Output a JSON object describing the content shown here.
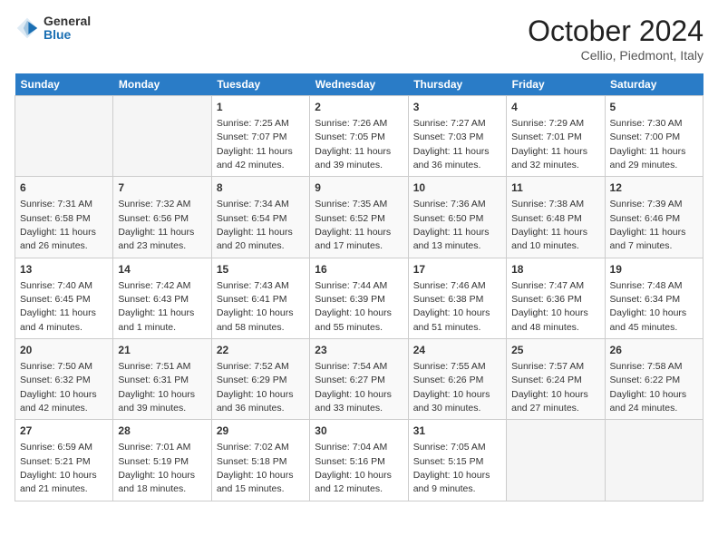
{
  "logo": {
    "general": "General",
    "blue": "Blue"
  },
  "title": "October 2024",
  "location": "Cellio, Piedmont, Italy",
  "days_header": [
    "Sunday",
    "Monday",
    "Tuesday",
    "Wednesday",
    "Thursday",
    "Friday",
    "Saturday"
  ],
  "weeks": [
    [
      {
        "day": "",
        "sunrise": "",
        "sunset": "",
        "daylight": ""
      },
      {
        "day": "",
        "sunrise": "",
        "sunset": "",
        "daylight": ""
      },
      {
        "day": "1",
        "sunrise": "Sunrise: 7:25 AM",
        "sunset": "Sunset: 7:07 PM",
        "daylight": "Daylight: 11 hours and 42 minutes."
      },
      {
        "day": "2",
        "sunrise": "Sunrise: 7:26 AM",
        "sunset": "Sunset: 7:05 PM",
        "daylight": "Daylight: 11 hours and 39 minutes."
      },
      {
        "day": "3",
        "sunrise": "Sunrise: 7:27 AM",
        "sunset": "Sunset: 7:03 PM",
        "daylight": "Daylight: 11 hours and 36 minutes."
      },
      {
        "day": "4",
        "sunrise": "Sunrise: 7:29 AM",
        "sunset": "Sunset: 7:01 PM",
        "daylight": "Daylight: 11 hours and 32 minutes."
      },
      {
        "day": "5",
        "sunrise": "Sunrise: 7:30 AM",
        "sunset": "Sunset: 7:00 PM",
        "daylight": "Daylight: 11 hours and 29 minutes."
      }
    ],
    [
      {
        "day": "6",
        "sunrise": "Sunrise: 7:31 AM",
        "sunset": "Sunset: 6:58 PM",
        "daylight": "Daylight: 11 hours and 26 minutes."
      },
      {
        "day": "7",
        "sunrise": "Sunrise: 7:32 AM",
        "sunset": "Sunset: 6:56 PM",
        "daylight": "Daylight: 11 hours and 23 minutes."
      },
      {
        "day": "8",
        "sunrise": "Sunrise: 7:34 AM",
        "sunset": "Sunset: 6:54 PM",
        "daylight": "Daylight: 11 hours and 20 minutes."
      },
      {
        "day": "9",
        "sunrise": "Sunrise: 7:35 AM",
        "sunset": "Sunset: 6:52 PM",
        "daylight": "Daylight: 11 hours and 17 minutes."
      },
      {
        "day": "10",
        "sunrise": "Sunrise: 7:36 AM",
        "sunset": "Sunset: 6:50 PM",
        "daylight": "Daylight: 11 hours and 13 minutes."
      },
      {
        "day": "11",
        "sunrise": "Sunrise: 7:38 AM",
        "sunset": "Sunset: 6:48 PM",
        "daylight": "Daylight: 11 hours and 10 minutes."
      },
      {
        "day": "12",
        "sunrise": "Sunrise: 7:39 AM",
        "sunset": "Sunset: 6:46 PM",
        "daylight": "Daylight: 11 hours and 7 minutes."
      }
    ],
    [
      {
        "day": "13",
        "sunrise": "Sunrise: 7:40 AM",
        "sunset": "Sunset: 6:45 PM",
        "daylight": "Daylight: 11 hours and 4 minutes."
      },
      {
        "day": "14",
        "sunrise": "Sunrise: 7:42 AM",
        "sunset": "Sunset: 6:43 PM",
        "daylight": "Daylight: 11 hours and 1 minute."
      },
      {
        "day": "15",
        "sunrise": "Sunrise: 7:43 AM",
        "sunset": "Sunset: 6:41 PM",
        "daylight": "Daylight: 10 hours and 58 minutes."
      },
      {
        "day": "16",
        "sunrise": "Sunrise: 7:44 AM",
        "sunset": "Sunset: 6:39 PM",
        "daylight": "Daylight: 10 hours and 55 minutes."
      },
      {
        "day": "17",
        "sunrise": "Sunrise: 7:46 AM",
        "sunset": "Sunset: 6:38 PM",
        "daylight": "Daylight: 10 hours and 51 minutes."
      },
      {
        "day": "18",
        "sunrise": "Sunrise: 7:47 AM",
        "sunset": "Sunset: 6:36 PM",
        "daylight": "Daylight: 10 hours and 48 minutes."
      },
      {
        "day": "19",
        "sunrise": "Sunrise: 7:48 AM",
        "sunset": "Sunset: 6:34 PM",
        "daylight": "Daylight: 10 hours and 45 minutes."
      }
    ],
    [
      {
        "day": "20",
        "sunrise": "Sunrise: 7:50 AM",
        "sunset": "Sunset: 6:32 PM",
        "daylight": "Daylight: 10 hours and 42 minutes."
      },
      {
        "day": "21",
        "sunrise": "Sunrise: 7:51 AM",
        "sunset": "Sunset: 6:31 PM",
        "daylight": "Daylight: 10 hours and 39 minutes."
      },
      {
        "day": "22",
        "sunrise": "Sunrise: 7:52 AM",
        "sunset": "Sunset: 6:29 PM",
        "daylight": "Daylight: 10 hours and 36 minutes."
      },
      {
        "day": "23",
        "sunrise": "Sunrise: 7:54 AM",
        "sunset": "Sunset: 6:27 PM",
        "daylight": "Daylight: 10 hours and 33 minutes."
      },
      {
        "day": "24",
        "sunrise": "Sunrise: 7:55 AM",
        "sunset": "Sunset: 6:26 PM",
        "daylight": "Daylight: 10 hours and 30 minutes."
      },
      {
        "day": "25",
        "sunrise": "Sunrise: 7:57 AM",
        "sunset": "Sunset: 6:24 PM",
        "daylight": "Daylight: 10 hours and 27 minutes."
      },
      {
        "day": "26",
        "sunrise": "Sunrise: 7:58 AM",
        "sunset": "Sunset: 6:22 PM",
        "daylight": "Daylight: 10 hours and 24 minutes."
      }
    ],
    [
      {
        "day": "27",
        "sunrise": "Sunrise: 6:59 AM",
        "sunset": "Sunset: 5:21 PM",
        "daylight": "Daylight: 10 hours and 21 minutes."
      },
      {
        "day": "28",
        "sunrise": "Sunrise: 7:01 AM",
        "sunset": "Sunset: 5:19 PM",
        "daylight": "Daylight: 10 hours and 18 minutes."
      },
      {
        "day": "29",
        "sunrise": "Sunrise: 7:02 AM",
        "sunset": "Sunset: 5:18 PM",
        "daylight": "Daylight: 10 hours and 15 minutes."
      },
      {
        "day": "30",
        "sunrise": "Sunrise: 7:04 AM",
        "sunset": "Sunset: 5:16 PM",
        "daylight": "Daylight: 10 hours and 12 minutes."
      },
      {
        "day": "31",
        "sunrise": "Sunrise: 7:05 AM",
        "sunset": "Sunset: 5:15 PM",
        "daylight": "Daylight: 10 hours and 9 minutes."
      },
      {
        "day": "",
        "sunrise": "",
        "sunset": "",
        "daylight": ""
      },
      {
        "day": "",
        "sunrise": "",
        "sunset": "",
        "daylight": ""
      }
    ]
  ]
}
